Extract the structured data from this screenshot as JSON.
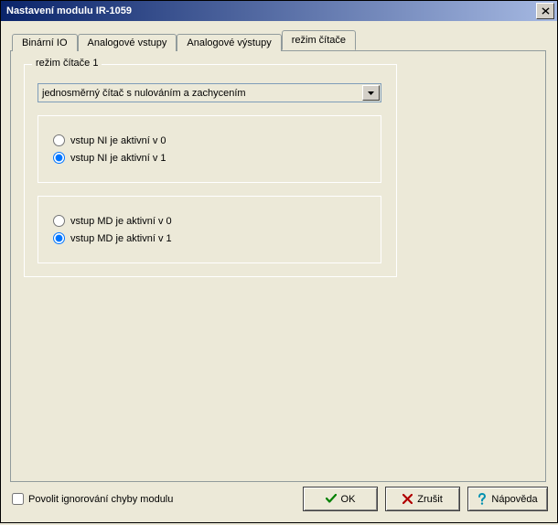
{
  "window": {
    "title": "Nastavení modulu IR-1059"
  },
  "tabs": [
    {
      "label": "Binární IO"
    },
    {
      "label": "Analogové vstupy"
    },
    {
      "label": "Analogové výstupy"
    },
    {
      "label": "režim čítače"
    }
  ],
  "group": {
    "title": "režim čítače 1",
    "dropdown": {
      "selected": "jednosměrný čítač s nulováním a zachycením"
    },
    "radio_ni": {
      "opt0": "vstup NI je aktivní v 0",
      "opt1": "vstup NI je aktivní v 1",
      "selected": "opt1"
    },
    "radio_md": {
      "opt0": "vstup MD je aktivní v 0",
      "opt1": "vstup MD je aktivní v 1",
      "selected": "opt1"
    }
  },
  "footer": {
    "checkbox_label": "Povolit ignorování chyby modulu",
    "ok_label": "OK",
    "cancel_label": "Zrušit",
    "help_label": "Nápověda"
  }
}
